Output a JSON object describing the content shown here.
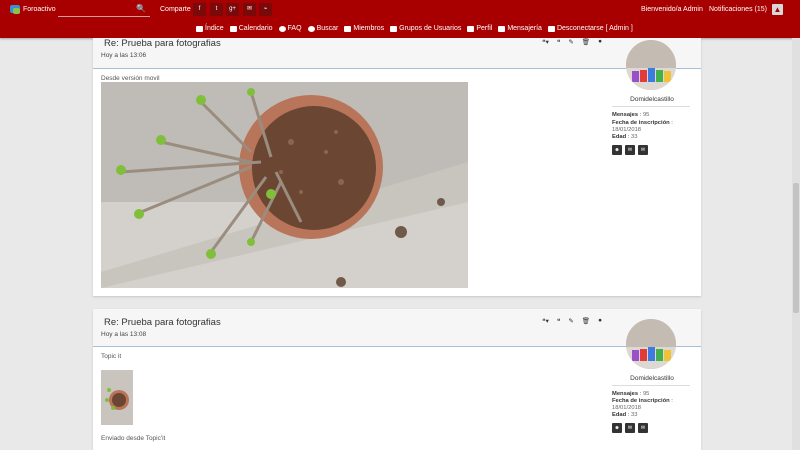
{
  "topbar": {
    "logo_text": "Foroactivo",
    "share_label": "Comparte :",
    "share_buttons": [
      {
        "icon": "facebook-icon",
        "glyph": "f"
      },
      {
        "icon": "twitter-icon",
        "glyph": "t"
      },
      {
        "icon": "google-plus-icon",
        "glyph": "g+"
      },
      {
        "icon": "mail-icon",
        "glyph": "✉"
      },
      {
        "icon": "rss-icon",
        "glyph": "⌁"
      }
    ],
    "welcome": "Bienvenido/a Admin",
    "notifications_label": "Notificaciones",
    "notifications_count": "(15)",
    "colors": {
      "bar": "#a80000",
      "share_button": "#7a0a0a"
    }
  },
  "nav": [
    {
      "label": "Índice",
      "icon": "home-icon"
    },
    {
      "label": "Calendario",
      "icon": "calendar-icon"
    },
    {
      "label": "FAQ",
      "icon": "help-icon"
    },
    {
      "label": "Buscar",
      "icon": "search-icon"
    },
    {
      "label": "Miembros",
      "icon": "members-icon"
    },
    {
      "label": "Grupos de Usuarios",
      "icon": "groups-icon"
    },
    {
      "label": "Perfil",
      "icon": "profile-icon"
    },
    {
      "label": "Mensajería",
      "icon": "mail-icon"
    },
    {
      "label": "Desconectarse [ Admin ]",
      "icon": "logout-icon"
    }
  ],
  "posts": [
    {
      "title": "Re: Prueba para fotografias",
      "time": "Hoy a las 13:06",
      "body_text": "Desde versión movil",
      "username": "Domidelcastillo",
      "stats": [
        {
          "label": "Mensajes",
          "value": "95"
        },
        {
          "label": "Fecha de inscripción",
          "value": "18/01/2018"
        },
        {
          "label": "Edad",
          "value": "33"
        }
      ]
    },
    {
      "title": "Re: Prueba para fotografias",
      "time": "Hoy a las 13:08",
      "body_text": "Topic it",
      "footer_text": "Enviado desde Topic'it",
      "username": "Domidelcastillo",
      "stats": [
        {
          "label": "Mensajes",
          "value": "95"
        },
        {
          "label": "Fecha de inscripción",
          "value": "18/01/2018"
        },
        {
          "label": "Edad",
          "value": "33"
        }
      ]
    }
  ]
}
